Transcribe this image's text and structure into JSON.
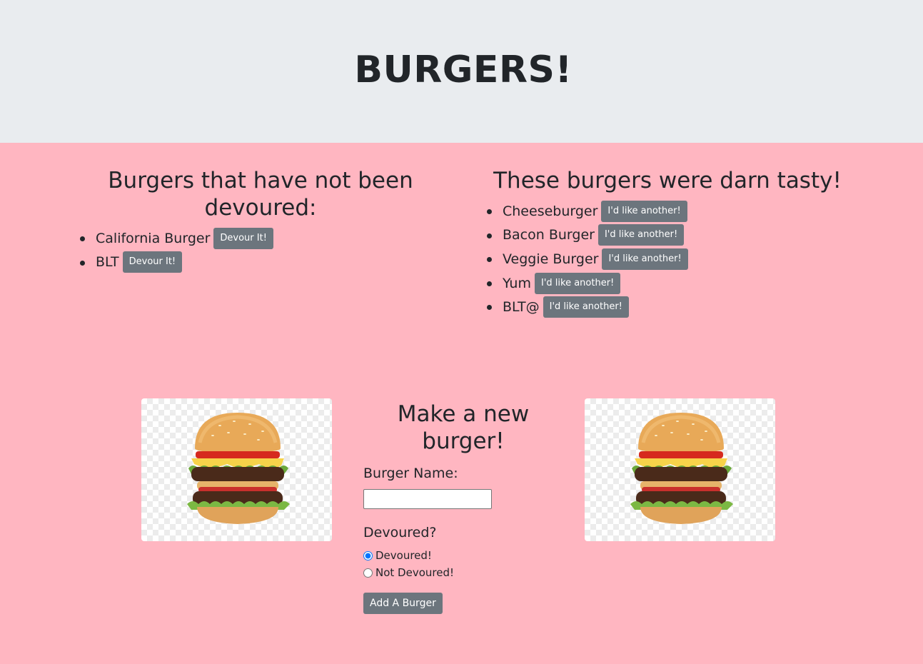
{
  "header": {
    "title": "BURGERS!"
  },
  "not_devoured": {
    "heading": "Burgers that have not been devoured:",
    "items": [
      {
        "name": "California Burger",
        "button": "Devour It!"
      },
      {
        "name": "BLT",
        "button": "Devour It!"
      }
    ]
  },
  "devoured": {
    "heading": "These burgers were darn tasty!",
    "items": [
      {
        "name": "Cheeseburger",
        "button": "I'd like another!"
      },
      {
        "name": "Bacon Burger",
        "button": "I'd like another!"
      },
      {
        "name": "Veggie Burger",
        "button": "I'd like another!"
      },
      {
        "name": "Yum",
        "button": "I'd like another!"
      },
      {
        "name": "BLT@",
        "button": "I'd like another!"
      }
    ]
  },
  "form": {
    "heading": "Make a new burger!",
    "name_label": "Burger Name:",
    "name_value": "",
    "devoured_label": "Devoured?",
    "options": [
      {
        "label": "Devoured!",
        "checked": true
      },
      {
        "label": "Not Devoured!",
        "checked": false
      }
    ],
    "submit_label": "Add A Burger"
  },
  "colors": {
    "page_background": "#ffb6c1",
    "header_background": "#e9ecef",
    "button": "#6c757d"
  },
  "icons": [
    "burger-image"
  ]
}
